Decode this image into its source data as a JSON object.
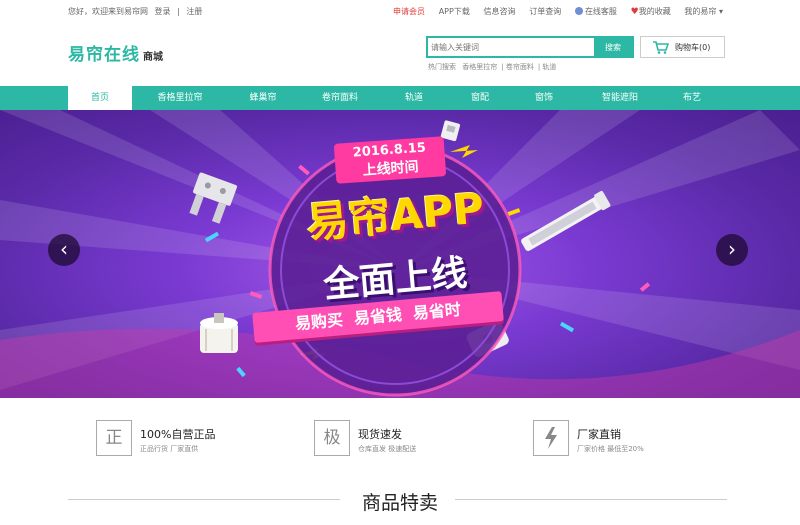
{
  "topbar": {
    "welcome": "您好，欢迎来到易帘网",
    "login": "登录",
    "register": "注册",
    "links": [
      "申请会员",
      "APP下载",
      "信息咨询",
      "订单查询",
      "在线客服",
      "我的收藏",
      "我的易帘 ▾"
    ]
  },
  "header": {
    "logo": "易帘在线",
    "logo_suffix": "商城",
    "search_placeholder": "请输入关键词",
    "search_button": "搜索",
    "hot_words": [
      "热门搜索",
      "香格里拉帘",
      "卷帘面料",
      "轨道"
    ],
    "cart_label": "购物车(0)"
  },
  "nav": {
    "items": [
      "首页",
      "香格里拉帘",
      "蜂巢帘",
      "卷帘面料",
      "轨道",
      "窗配",
      "窗饰",
      "智能遮阳",
      "布艺"
    ]
  },
  "banner": {
    "date": "2016.8.15",
    "launch": "上线时间",
    "headline": "易帘APP",
    "subline": "全面上线",
    "slogan": "易购买  易省钱  易省时",
    "prev": "‹",
    "next": "›"
  },
  "features": [
    {
      "icon_char": "正",
      "title": "100%自营正品",
      "sub": "正品行货  厂家直供"
    },
    {
      "icon_char": "极",
      "title": "现货速发",
      "sub": "仓库直发  极速配送"
    },
    {
      "icon_char": "",
      "title": "厂家直销",
      "sub": "厂家价格  最低至20%"
    }
  ],
  "section_title": "商品特卖",
  "colors": {
    "accent": "#2cb8a5",
    "banner": "#7a3ad2",
    "highlight": "#ffd800",
    "pink": "#ff5bbd"
  }
}
